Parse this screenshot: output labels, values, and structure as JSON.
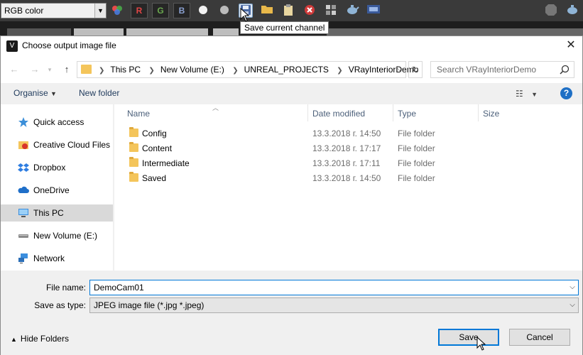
{
  "vfb_toolbar": {
    "channel_value": "RGB color",
    "buttons": [
      "R",
      "G",
      "B"
    ],
    "tooltip": "Save current channel"
  },
  "dialog": {
    "title": "Choose output image file",
    "breadcrumbs": [
      "This PC",
      "New Volume (E:)",
      "UNREAL_PROJECTS",
      "VRayInteriorDemo"
    ],
    "search_placeholder": "Search VRayInteriorDemo",
    "commands": {
      "organise": "Organise",
      "new_folder": "New folder"
    },
    "nav_items": [
      "Quick access",
      "Creative Cloud Files",
      "Dropbox",
      "OneDrive",
      "This PC",
      "New Volume (E:)",
      "Network"
    ],
    "selected_nav": "This PC",
    "columns": {
      "name": "Name",
      "date": "Date modified",
      "type": "Type",
      "size": "Size"
    },
    "files": [
      {
        "name": "Config",
        "date": "13.3.2018 г. 14:50",
        "type": "File folder"
      },
      {
        "name": "Content",
        "date": "13.3.2018 г. 17:17",
        "type": "File folder"
      },
      {
        "name": "Intermediate",
        "date": "13.3.2018 г. 17:11",
        "type": "File folder"
      },
      {
        "name": "Saved",
        "date": "13.3.2018 г. 14:50",
        "type": "File folder"
      }
    ],
    "file_name_label": "File name:",
    "file_name_value": "DemoCam01",
    "save_type_label": "Save as type:",
    "save_type_value": "JPEG image file (*.jpg *.jpeg)",
    "hide_folders": "Hide Folders",
    "save_button": "Save",
    "cancel_button": "Cancel"
  }
}
